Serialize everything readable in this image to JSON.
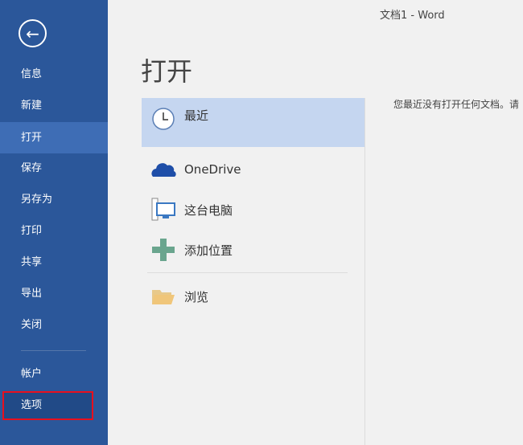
{
  "window_title": "文档1 - Word",
  "sidebar": {
    "items": [
      {
        "label": "信息"
      },
      {
        "label": "新建"
      },
      {
        "label": "打开",
        "selected": true
      },
      {
        "label": "保存"
      },
      {
        "label": "另存为"
      },
      {
        "label": "打印"
      },
      {
        "label": "共享"
      },
      {
        "label": "导出"
      },
      {
        "label": "关闭"
      }
    ],
    "account": "帐户",
    "options": "选项"
  },
  "page_title": "打开",
  "locations": [
    {
      "label": "最近",
      "icon": "clock-icon"
    },
    {
      "label": "OneDrive",
      "icon": "cloud-icon"
    },
    {
      "label": "这台电脑",
      "icon": "computer-icon"
    },
    {
      "label": "添加位置",
      "icon": "plus-icon"
    },
    {
      "label": "浏览",
      "icon": "folder-icon"
    }
  ],
  "empty_message": "您最近没有打开任何文档。请"
}
